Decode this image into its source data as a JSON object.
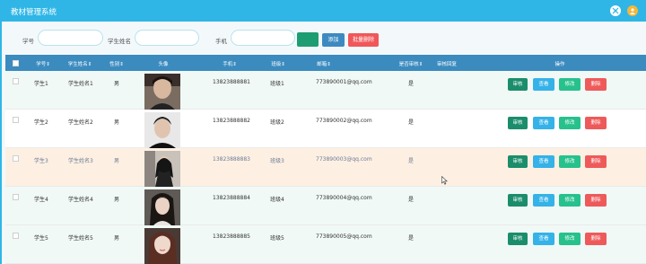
{
  "header": {
    "title": "教材管理系统",
    "gear_icon": "settings-icon",
    "avatar_icon": "user-avatar-icon"
  },
  "search": {
    "student_no_label": "学号",
    "student_name_label": "学生姓名",
    "phone_label": "手机",
    "student_no_value": "",
    "student_name_value": "",
    "phone_value": "",
    "search_button_label": "",
    "add_button_label": "添加",
    "batch_delete_label": "批量删除"
  },
  "table": {
    "columns": [
      "学号⇕",
      "学生姓名⇕",
      "性别⇕",
      "头像",
      "手机⇕",
      "班级⇕",
      "邮箱⇕",
      "是否审核⇕",
      "审核回复",
      "操作"
    ],
    "rows": [
      {
        "id": "学生1",
        "name": "学生姓名1",
        "gender": "男",
        "phone": "13823888881",
        "class": "班级1",
        "email": "773890001@qq.com",
        "reviewed": "是",
        "reply": ""
      },
      {
        "id": "学生2",
        "name": "学生姓名2",
        "gender": "男",
        "phone": "13823888882",
        "class": "班级2",
        "email": "773890002@qq.com",
        "reviewed": "是",
        "reply": ""
      },
      {
        "id": "学生3",
        "name": "学生姓名3",
        "gender": "男",
        "phone": "13823888883",
        "class": "班级3",
        "email": "773890003@qq.com",
        "reviewed": "是",
        "reply": ""
      },
      {
        "id": "学生4",
        "name": "学生姓名4",
        "gender": "男",
        "phone": "13823888884",
        "class": "班级4",
        "email": "773890004@qq.com",
        "reviewed": "是",
        "reply": ""
      },
      {
        "id": "学生5",
        "name": "学生姓名5",
        "gender": "男",
        "phone": "13823888885",
        "class": "班级5",
        "email": "773890005@qq.com",
        "reviewed": "是",
        "reply": ""
      }
    ],
    "actions": {
      "review": "审核",
      "view": "查看",
      "edit": "修改",
      "delete": "删除"
    }
  },
  "colors": {
    "topbar": "#2fb6e6",
    "table_header": "#3b8bbf",
    "review_button": "#1b8d6a",
    "view_button": "#35b2e8",
    "edit_button": "#27c18c",
    "delete_button": "#ee5a5a",
    "highlight_row": "#fdf0e2"
  }
}
